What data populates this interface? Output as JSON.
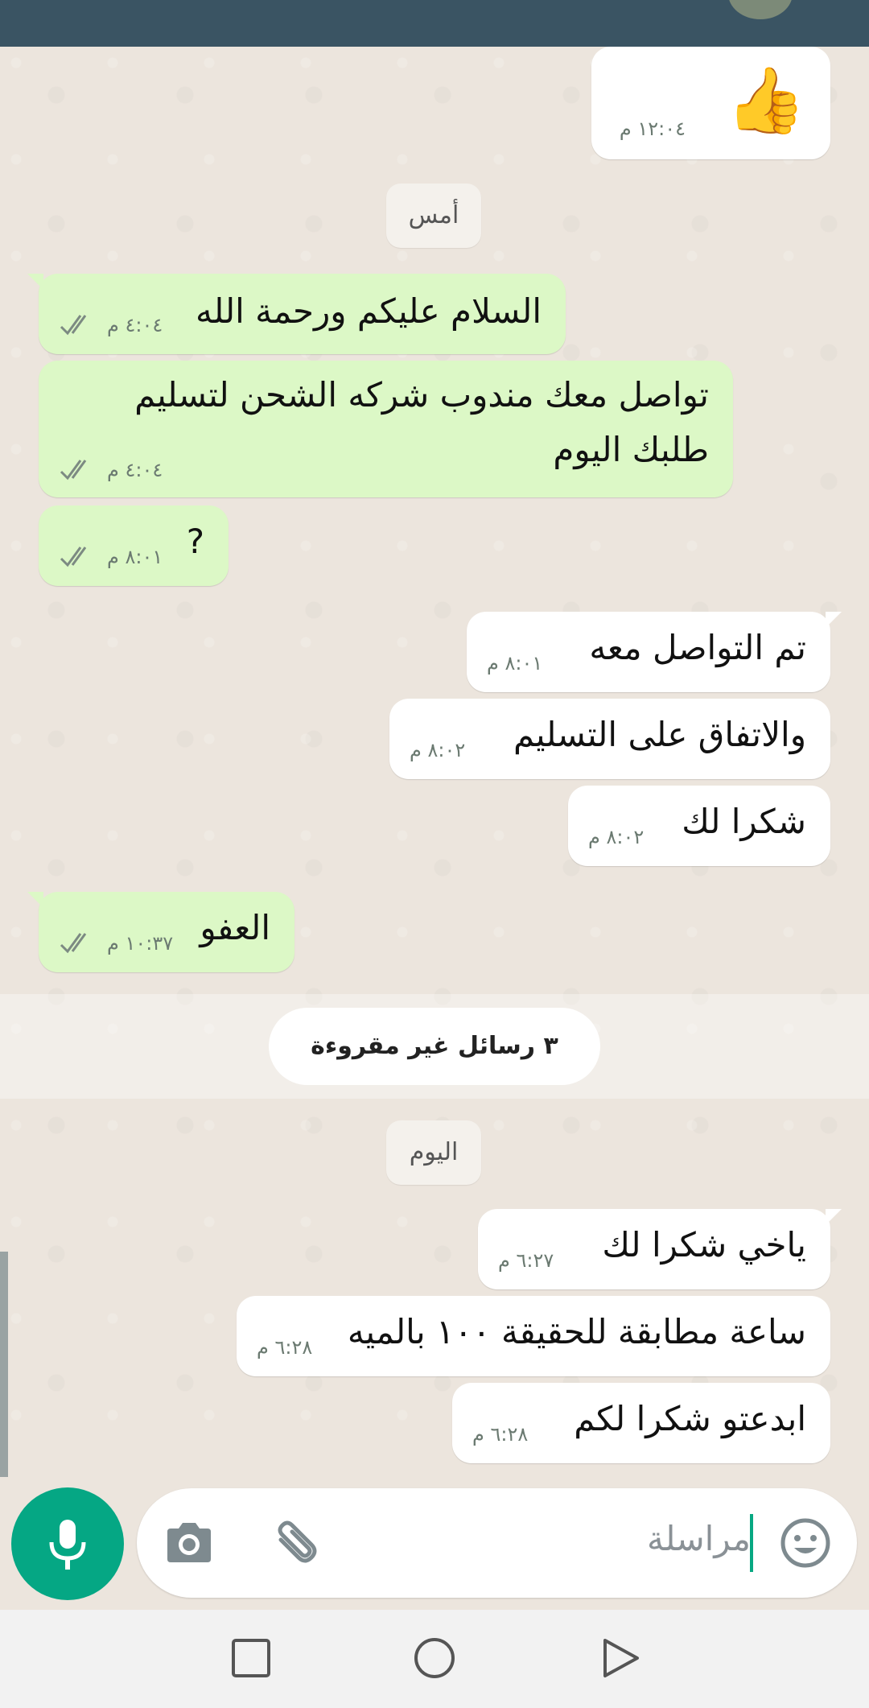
{
  "chat": {
    "date_yesterday": "أمس",
    "date_today": "اليوم",
    "unread_banner": "٣ رسائل غير مقروءة",
    "messages": [
      {
        "dir": "out",
        "text": "👍",
        "time": "١٢:٠٤ م"
      },
      {
        "dir": "in",
        "text": "السلام عليكم ورحمة الله",
        "time": "٤:٠٤ م",
        "status": "read"
      },
      {
        "dir": "in",
        "text_line1": "تواصل معك مندوب شركه الشحن لتسليم",
        "text_line2": "طلبك اليوم",
        "time": "٤:٠٤ م",
        "status": "read"
      },
      {
        "dir": "in",
        "text": "?",
        "time": "٨:٠١ م",
        "status": "read"
      },
      {
        "dir": "out",
        "text": "تم التواصل معه",
        "time": "٨:٠١ م"
      },
      {
        "dir": "out",
        "text": "والاتفاق على التسليم",
        "time": "٨:٠٢ م"
      },
      {
        "dir": "out",
        "text": "شكرا لك",
        "time": "٨:٠٢ م"
      },
      {
        "dir": "in",
        "text": "العفو",
        "time": "١٠:٣٧ م",
        "status": "read"
      },
      {
        "dir": "out",
        "text": "ياخي شكرا لك",
        "time": "٦:٢٧ م"
      },
      {
        "dir": "out",
        "text": "ساعة مطابقة للحقيقة ١٠٠ بالميه",
        "time": "٦:٢٨ م"
      },
      {
        "dir": "out",
        "text": "ابدعتو شكرا لكم",
        "time": "٦:٢٨ م"
      }
    ]
  },
  "composer": {
    "placeholder": "مراسلة",
    "icons": [
      "emoji-icon",
      "paperclip-icon",
      "camera-icon",
      "microphone-icon"
    ]
  },
  "navigation": {
    "icons": [
      "recents-square-icon",
      "home-circle-icon",
      "back-triangle-icon"
    ]
  },
  "colors": {
    "header": "#3a5463",
    "incoming_bubble": "#dcf8c6",
    "outgoing_bubble": "#ffffff",
    "chat_background": "#ece5dd",
    "accent": "#05a784"
  }
}
